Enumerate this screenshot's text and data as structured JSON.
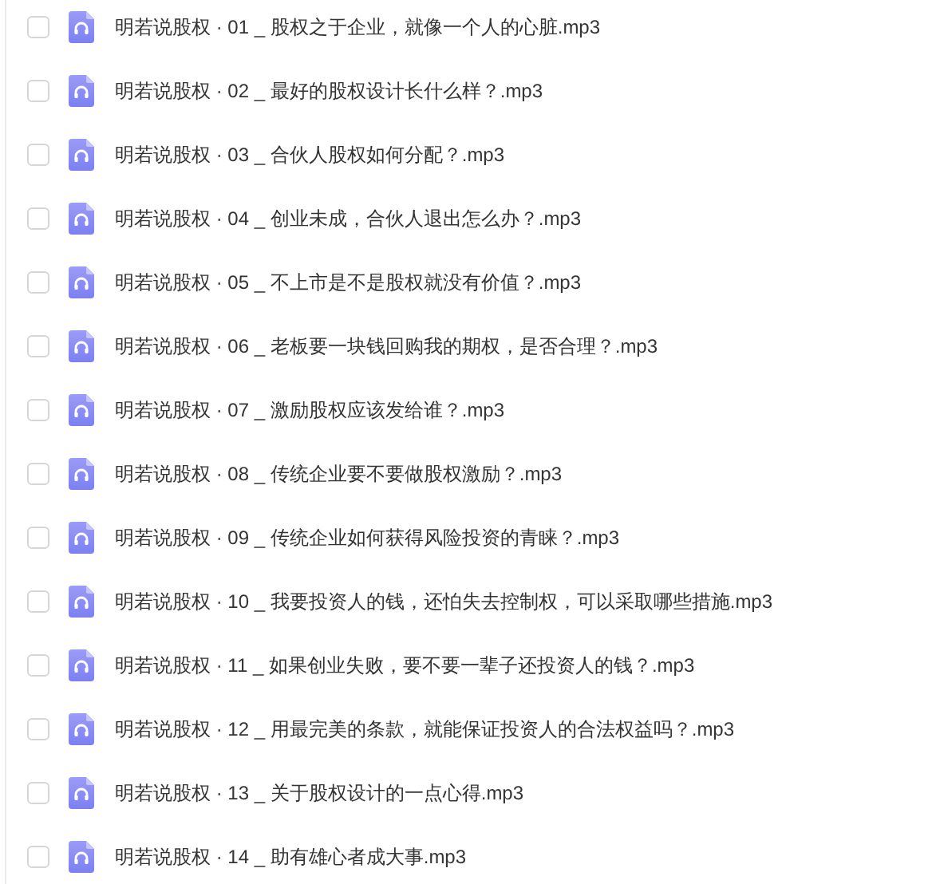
{
  "files": [
    {
      "name": "明若说股权 · 01 _ 股权之于企业，就像一个人的心脏.mp3",
      "checked": false
    },
    {
      "name": "明若说股权 · 02 _ 最好的股权设计长什么样？.mp3",
      "checked": false
    },
    {
      "name": "明若说股权 · 03 _ 合伙人股权如何分配？.mp3",
      "checked": false
    },
    {
      "name": "明若说股权 · 04 _ 创业未成，合伙人退出怎么办？.mp3",
      "checked": false
    },
    {
      "name": "明若说股权 · 05 _ 不上市是不是股权就没有价值？.mp3",
      "checked": false
    },
    {
      "name": "明若说股权 · 06 _ 老板要一块钱回购我的期权，是否合理？.mp3",
      "checked": false
    },
    {
      "name": "明若说股权 · 07 _ 激励股权应该发给谁？.mp3",
      "checked": false
    },
    {
      "name": "明若说股权 · 08 _ 传统企业要不要做股权激励？.mp3",
      "checked": false
    },
    {
      "name": "明若说股权 · 09 _ 传统企业如何获得风险投资的青睐？.mp3",
      "checked": false
    },
    {
      "name": "明若说股权 · 10 _ 我要投资人的钱，还怕失去控制权，可以采取哪些措施.mp3",
      "checked": false
    },
    {
      "name": "明若说股权 · 11 _ 如果创业失败，要不要一辈子还投资人的钱？.mp3",
      "checked": false
    },
    {
      "name": "明若说股权 · 12 _ 用最完美的条款，就能保证投资人的合法权益吗？.mp3",
      "checked": false
    },
    {
      "name": "明若说股权 · 13 _ 关于股权设计的一点心得.mp3",
      "checked": false
    },
    {
      "name": "明若说股权 · 14 _ 助有雄心者成大事.mp3",
      "checked": false
    }
  ]
}
